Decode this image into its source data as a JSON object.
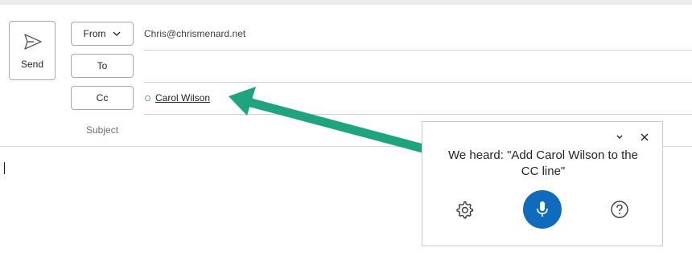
{
  "compose": {
    "send_label": "Send",
    "from_label": "From",
    "to_label": "To",
    "cc_label": "Cc",
    "from_address": "Chris@chrismenard.net",
    "cc_recipient": "Carol Wilson",
    "subject_placeholder": "Subject"
  },
  "dictation": {
    "heard_text": "We heard: \"Add Carol Wilson to the CC line\""
  },
  "colors": {
    "mic_accent": "#0f6cbd",
    "annotation_arrow": "#1fa47f"
  },
  "icons": [
    "send-icon",
    "chevron-down-icon",
    "presence-icon",
    "collapse-icon",
    "close-icon",
    "settings-icon",
    "microphone-icon",
    "help-icon"
  ]
}
